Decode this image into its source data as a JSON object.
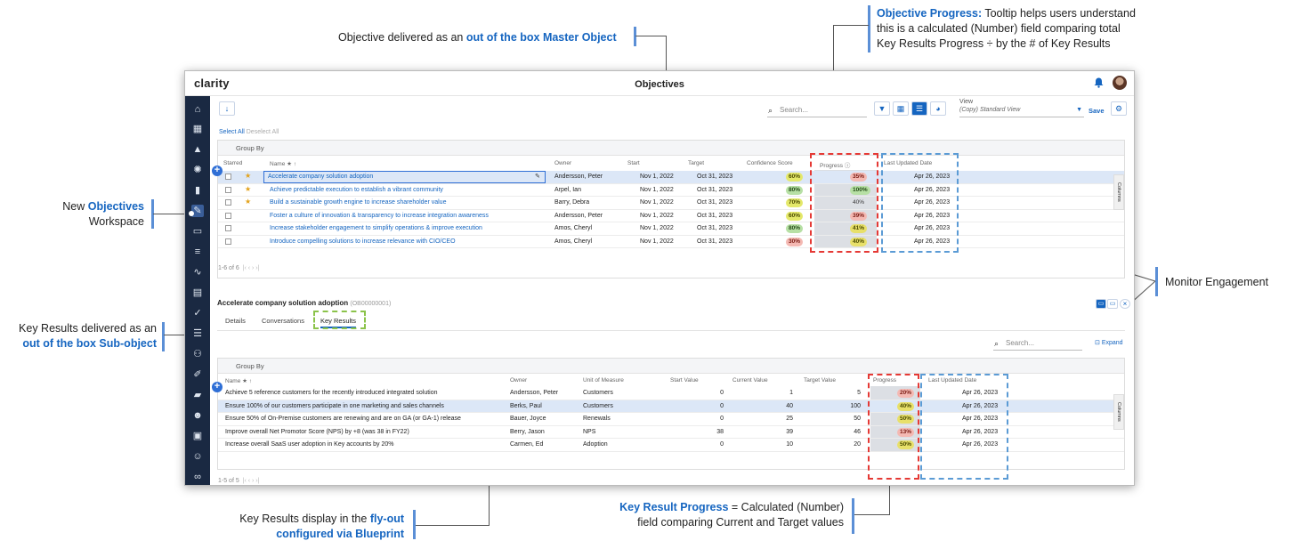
{
  "annotations": {
    "master_object_pre": "Objective delivered as an ",
    "master_object_hl": "out of the box Master Object",
    "obj_progress_hl": "Objective Progress:",
    "obj_progress_line1": " Tooltip helps users understand",
    "obj_progress_line2": "this is a calculated (Number) field comparing total",
    "obj_progress_line3": "Key Results Progress ÷ by the # of Key Results",
    "new_ws_pre": "New ",
    "new_ws_hl": "Objectives",
    "new_ws_line2": "Workspace",
    "kr_sub_line1": "Key Results delivered as an",
    "kr_sub_hl": "out of the box Sub-object",
    "monitor": "Monitor Engagement",
    "flyout_pre": "Key Results display in the ",
    "flyout_hl1": "fly-out",
    "flyout_hl2": "configured via Blueprint",
    "kr_progress_hl": "Key Result Progress",
    "kr_progress_line1": " = Calculated (Number)",
    "kr_progress_line2": "field comparing Current and Target values"
  },
  "app": {
    "logo": "clarity",
    "title": "Objectives",
    "search_placeholder": "Search...",
    "view_label": "View",
    "view_value": "(Copy) Standard View",
    "save_label": "Save",
    "select_all": "Select All",
    "deselect_all": "Deselect All",
    "group_by": "Group By",
    "columns_label": "Columns",
    "pager": "1-6 of 6",
    "pager_nav": "|‹  ‹  ›  ›|"
  },
  "objectives": {
    "headers": {
      "starred": "Starred",
      "name": "Name ★ ↑",
      "owner": "Owner",
      "start": "Start",
      "target": "Target",
      "confidence": "Confidence Score",
      "progress": "Progress",
      "updated": "Last Updated Date"
    },
    "rows": [
      {
        "star": "★",
        "name": "Accelerate company solution adoption",
        "owner": "Andersson, Peter",
        "start": "Nov 1, 2022",
        "target": "Oct 31, 2023",
        "confidence": "60%",
        "progress": "35%",
        "updated": "Apr 26, 2023"
      },
      {
        "star": "★",
        "name": "Achieve predictable execution to establish a vibrant community",
        "owner": "Arpel, Ian",
        "start": "Nov 1, 2022",
        "target": "Oct 31, 2023",
        "confidence": "80%",
        "progress": "100%",
        "updated": "Apr 26, 2023"
      },
      {
        "star": "★",
        "name": "Build a sustainable growth engine to increase shareholder value",
        "owner": "Barry, Debra",
        "start": "Nov 1, 2022",
        "target": "Oct 31, 2023",
        "confidence": "70%",
        "progress": "40%",
        "updated": "Apr 26, 2023"
      },
      {
        "star": "",
        "name": "Foster a culture of innovation & transparency to increase integration awareness",
        "owner": "Andersson, Peter",
        "start": "Nov 1, 2022",
        "target": "Oct 31, 2023",
        "confidence": "60%",
        "progress": "39%",
        "updated": "Apr 26, 2023"
      },
      {
        "star": "",
        "name": "Increase stakeholder engagement to simplify operations & improve execution",
        "owner": "Amos, Cheryl",
        "start": "Nov 1, 2022",
        "target": "Oct 31, 2023",
        "confidence": "80%",
        "progress": "41%",
        "updated": "Apr 26, 2023"
      },
      {
        "star": "",
        "name": "Introduce compelling solutions to increase relevance with CIO/CEO",
        "owner": "Amos, Cheryl",
        "start": "Nov 1, 2022",
        "target": "Oct 31, 2023",
        "confidence": "30%",
        "progress": "40%",
        "updated": "Apr 26, 2023"
      }
    ]
  },
  "flyout": {
    "title": "Accelerate company solution adoption",
    "code": "(OB00000001)",
    "tabs": [
      "Details",
      "Conversations",
      "Key Results"
    ],
    "search_placeholder": "Search...",
    "expand": "Expand",
    "group_by": "Group By",
    "columns_label": "Columns",
    "pager": "1-5 of 5",
    "pager_nav": "|‹  ‹  ›  ›|",
    "headers": {
      "name": "Name ★ ↑",
      "owner": "Owner",
      "unit": "Unit of Measure",
      "start": "Start Value",
      "current": "Current Value",
      "target": "Target Value",
      "progress": "Progress",
      "updated": "Last Updated Date"
    },
    "rows": [
      {
        "name": "Achieve 5 reference customers for the recently introduced integrated solution",
        "owner": "Andersson, Peter",
        "unit": "Customers",
        "start": "0",
        "current": "1",
        "target": "5",
        "progress": "20%",
        "updated": "Apr 26, 2023"
      },
      {
        "name": "Ensure 100% of our customers participate in one marketing and sales channels",
        "owner": "Berks, Paul",
        "unit": "Customers",
        "start": "0",
        "current": "40",
        "target": "100",
        "progress": "40%",
        "updated": "Apr 26, 2023"
      },
      {
        "name": "Ensure 50% of On-Premise customers are renewing and are on GA (or GA-1) release",
        "owner": "Bauer, Joyce",
        "unit": "Renewals",
        "start": "0",
        "current": "25",
        "target": "50",
        "progress": "50%",
        "updated": "Apr 26, 2023"
      },
      {
        "name": "Improve overall Net Promotor Score (NPS) by +8 (was 38 in FY22)",
        "owner": "Berry, Jason",
        "unit": "NPS",
        "start": "38",
        "current": "39",
        "target": "46",
        "progress": "13%",
        "updated": "Apr 26, 2023"
      },
      {
        "name": "Increase overall SaaS user adoption in Key accounts by 20%",
        "owner": "Carmen, Ed",
        "unit": "Adoption",
        "start": "0",
        "current": "10",
        "target": "20",
        "progress": "50%",
        "updated": "Apr 26, 2023"
      }
    ]
  },
  "colors": {
    "accent": "#1565c0",
    "nav_bg": "#1a2942",
    "red_dash": "#e53935",
    "blue_dash": "#5b9bd5",
    "green_dash": "#8bc34a"
  }
}
